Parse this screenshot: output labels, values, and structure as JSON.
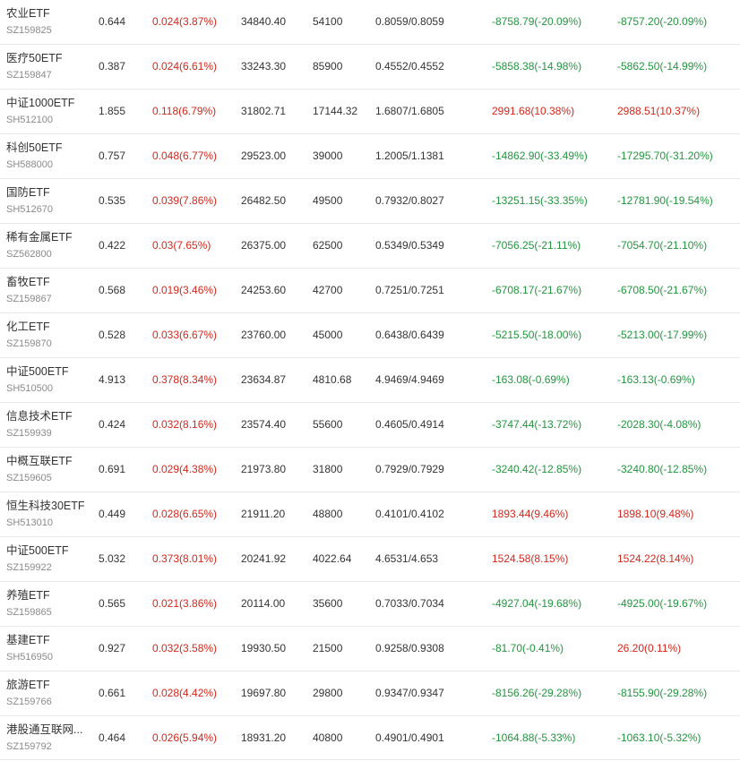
{
  "colors": {
    "up": "#d4271c",
    "down": "#23953f",
    "text": "#333333",
    "subtext": "#8a8a8a",
    "divider": "#e8e8e8"
  },
  "rows": [
    {
      "name": "农业ETF",
      "code": "SZ159825",
      "price": "0.644",
      "change": "0.024(3.87%)",
      "change_dir": "up",
      "amount": "34840.40",
      "volume": "54100",
      "bid_ask": "0.8059/0.8059",
      "pnl1": "-8758.79(-20.09%)",
      "pnl1_dir": "down",
      "pnl2": "-8757.20(-20.09%)",
      "pnl2_dir": "down"
    },
    {
      "name": "医疗50ETF",
      "code": "SZ159847",
      "price": "0.387",
      "change": "0.024(6.61%)",
      "change_dir": "up",
      "amount": "33243.30",
      "volume": "85900",
      "bid_ask": "0.4552/0.4552",
      "pnl1": "-5858.38(-14.98%)",
      "pnl1_dir": "down",
      "pnl2": "-5862.50(-14.99%)",
      "pnl2_dir": "down"
    },
    {
      "name": "中证1000ETF",
      "code": "SH512100",
      "price": "1.855",
      "change": "0.118(6.79%)",
      "change_dir": "up",
      "amount": "31802.71",
      "volume": "17144.32",
      "bid_ask": "1.6807/1.6805",
      "pnl1": "2991.68(10.38%)",
      "pnl1_dir": "up",
      "pnl2": "2988.51(10.37%)",
      "pnl2_dir": "up"
    },
    {
      "name": "科创50ETF",
      "code": "SH588000",
      "price": "0.757",
      "change": "0.048(6.77%)",
      "change_dir": "up",
      "amount": "29523.00",
      "volume": "39000",
      "bid_ask": "1.2005/1.1381",
      "pnl1": "-14862.90(-33.49%)",
      "pnl1_dir": "down",
      "pnl2": "-17295.70(-31.20%)",
      "pnl2_dir": "down"
    },
    {
      "name": "国防ETF",
      "code": "SH512670",
      "price": "0.535",
      "change": "0.039(7.86%)",
      "change_dir": "up",
      "amount": "26482.50",
      "volume": "49500",
      "bid_ask": "0.7932/0.8027",
      "pnl1": "-13251.15(-33.35%)",
      "pnl1_dir": "down",
      "pnl2": "-12781.90(-19.54%)",
      "pnl2_dir": "down"
    },
    {
      "name": "稀有金属ETF",
      "code": "SZ562800",
      "price": "0.422",
      "change": "0.03(7.65%)",
      "change_dir": "up",
      "amount": "26375.00",
      "volume": "62500",
      "bid_ask": "0.5349/0.5349",
      "pnl1": "-7056.25(-21.11%)",
      "pnl1_dir": "down",
      "pnl2": "-7054.70(-21.10%)",
      "pnl2_dir": "down"
    },
    {
      "name": "畜牧ETF",
      "code": "SZ159867",
      "price": "0.568",
      "change": "0.019(3.46%)",
      "change_dir": "up",
      "amount": "24253.60",
      "volume": "42700",
      "bid_ask": "0.7251/0.7251",
      "pnl1": "-6708.17(-21.67%)",
      "pnl1_dir": "down",
      "pnl2": "-6708.50(-21.67%)",
      "pnl2_dir": "down"
    },
    {
      "name": "化工ETF",
      "code": "SZ159870",
      "price": "0.528",
      "change": "0.033(6.67%)",
      "change_dir": "up",
      "amount": "23760.00",
      "volume": "45000",
      "bid_ask": "0.6438/0.6439",
      "pnl1": "-5215.50(-18.00%)",
      "pnl1_dir": "down",
      "pnl2": "-5213.00(-17.99%)",
      "pnl2_dir": "down"
    },
    {
      "name": "中证500ETF",
      "code": "SH510500",
      "price": "4.913",
      "change": "0.378(8.34%)",
      "change_dir": "up",
      "amount": "23634.87",
      "volume": "4810.68",
      "bid_ask": "4.9469/4.9469",
      "pnl1": "-163.08(-0.69%)",
      "pnl1_dir": "down",
      "pnl2": "-163.13(-0.69%)",
      "pnl2_dir": "down"
    },
    {
      "name": "信息技术ETF",
      "code": "SZ159939",
      "price": "0.424",
      "change": "0.032(8.16%)",
      "change_dir": "up",
      "amount": "23574.40",
      "volume": "55600",
      "bid_ask": "0.4605/0.4914",
      "pnl1": "-3747.44(-13.72%)",
      "pnl1_dir": "down",
      "pnl2": "-2028.30(-4.08%)",
      "pnl2_dir": "down"
    },
    {
      "name": "中概互联ETF",
      "code": "SZ159605",
      "price": "0.691",
      "change": "0.029(4.38%)",
      "change_dir": "up",
      "amount": "21973.80",
      "volume": "31800",
      "bid_ask": "0.7929/0.7929",
      "pnl1": "-3240.42(-12.85%)",
      "pnl1_dir": "down",
      "pnl2": "-3240.80(-12.85%)",
      "pnl2_dir": "down"
    },
    {
      "name": "恒生科技30ETF",
      "code": "SH513010",
      "price": "0.449",
      "change": "0.028(6.65%)",
      "change_dir": "up",
      "amount": "21911.20",
      "volume": "48800",
      "bid_ask": "0.4101/0.4102",
      "pnl1": "1893.44(9.46%)",
      "pnl1_dir": "up",
      "pnl2": "1898.10(9.48%)",
      "pnl2_dir": "up"
    },
    {
      "name": "中证500ETF",
      "code": "SZ159922",
      "price": "5.032",
      "change": "0.373(8.01%)",
      "change_dir": "up",
      "amount": "20241.92",
      "volume": "4022.64",
      "bid_ask": "4.6531/4.653",
      "pnl1": "1524.58(8.15%)",
      "pnl1_dir": "up",
      "pnl2": "1524.22(8.14%)",
      "pnl2_dir": "up"
    },
    {
      "name": "养殖ETF",
      "code": "SZ159865",
      "price": "0.565",
      "change": "0.021(3.86%)",
      "change_dir": "up",
      "amount": "20114.00",
      "volume": "35600",
      "bid_ask": "0.7033/0.7034",
      "pnl1": "-4927.04(-19.68%)",
      "pnl1_dir": "down",
      "pnl2": "-4925.00(-19.67%)",
      "pnl2_dir": "down"
    },
    {
      "name": "基建ETF",
      "code": "SH516950",
      "price": "0.927",
      "change": "0.032(3.58%)",
      "change_dir": "up",
      "amount": "19930.50",
      "volume": "21500",
      "bid_ask": "0.9258/0.9308",
      "pnl1": "-81.70(-0.41%)",
      "pnl1_dir": "down",
      "pnl2": "26.20(0.11%)",
      "pnl2_dir": "up"
    },
    {
      "name": "旅游ETF",
      "code": "SZ159766",
      "price": "0.661",
      "change": "0.028(4.42%)",
      "change_dir": "up",
      "amount": "19697.80",
      "volume": "29800",
      "bid_ask": "0.9347/0.9347",
      "pnl1": "-8156.26(-29.28%)",
      "pnl1_dir": "down",
      "pnl2": "-8155.90(-29.28%)",
      "pnl2_dir": "down"
    },
    {
      "name": "港股通互联网...",
      "code": "SZ159792",
      "price": "0.464",
      "change": "0.026(5.94%)",
      "change_dir": "up",
      "amount": "18931.20",
      "volume": "40800",
      "bid_ask": "0.4901/0.4901",
      "pnl1": "-1064.88(-5.33%)",
      "pnl1_dir": "down",
      "pnl2": "-1063.10(-5.32%)",
      "pnl2_dir": "down"
    }
  ]
}
